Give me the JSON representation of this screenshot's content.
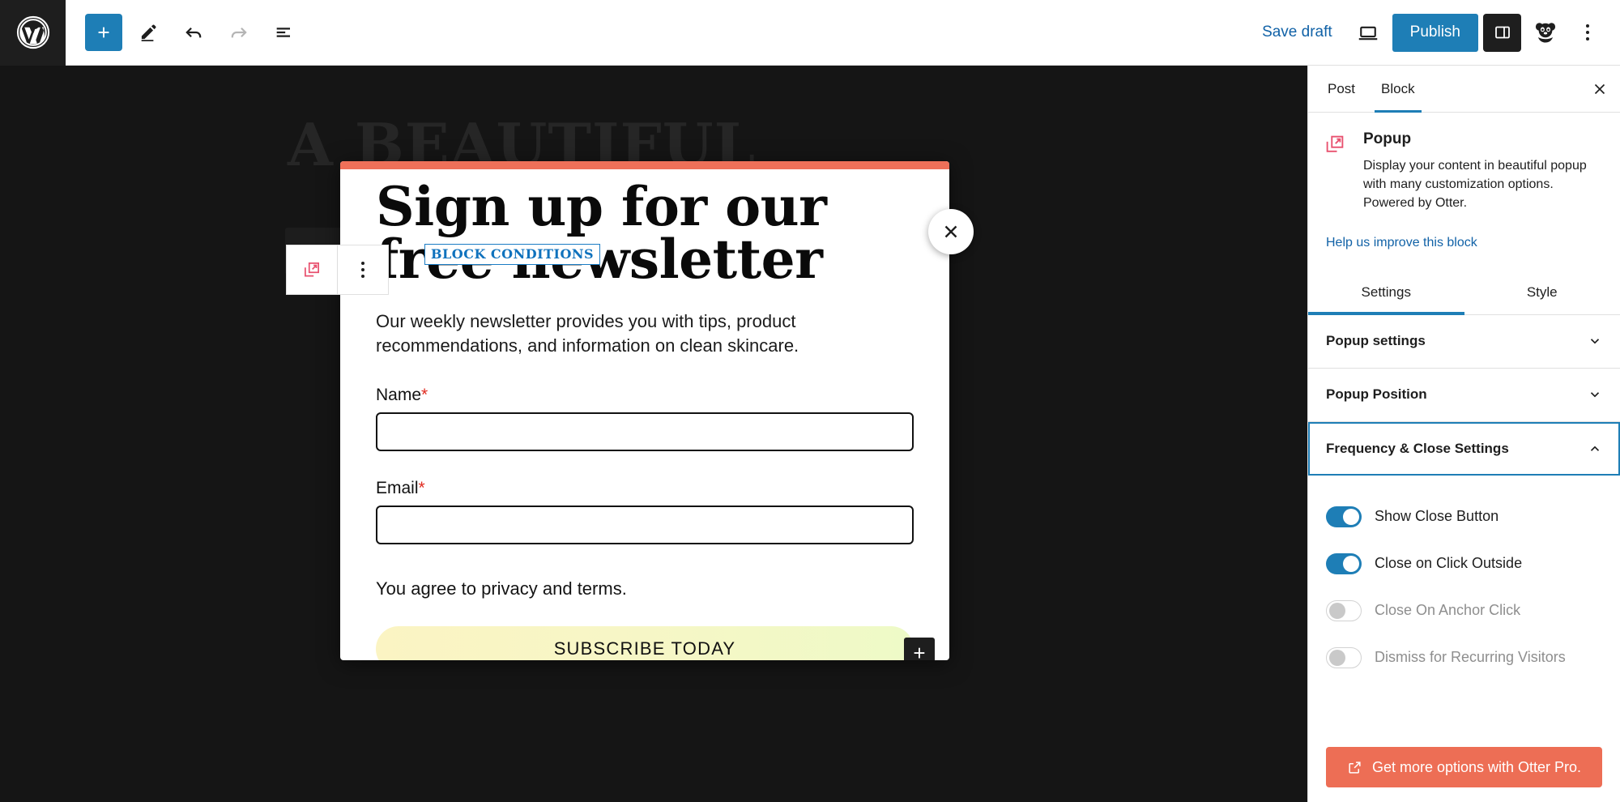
{
  "topbar": {
    "logo_icon": "wordpress-logo-icon",
    "add_block_icon": "plus-icon",
    "tools_icon": "pencil-icon",
    "undo_icon": "undo-arrow-icon",
    "redo_icon": "redo-arrow-icon",
    "list_view_icon": "document-outline-icon",
    "save_draft_label": "Save draft",
    "preview_icon": "laptop-preview-icon",
    "publish_label": "Publish",
    "settings_toggle_icon": "sidebar-panel-icon",
    "avatar_icon": "panda-avatar-icon",
    "more_icon": "kebab-menu-icon"
  },
  "canvas": {
    "ghost_title": "A BEAUTIFUL",
    "background_color": "#151515"
  },
  "block_toolbar": {
    "block_type_icon": "popup-block-icon",
    "more_options_icon": "kebab-menu-icon"
  },
  "popup": {
    "accent_color": "#ee7059",
    "title": "Sign up for our free newsletter",
    "description": "Our weekly newsletter provides you with tips, product recommendations, and information on clean skincare.",
    "block_conditions_badge": "BLOCK CONDITIONS",
    "close_icon": "close-x-icon",
    "fields": [
      {
        "label": "Name",
        "required": "*",
        "value": "",
        "placeholder": ""
      },
      {
        "label": "Email",
        "required": "*",
        "value": "",
        "placeholder": ""
      }
    ],
    "agree_text": "You agree to privacy and terms.",
    "subscribe_label": "SUBSCRIBE TODAY",
    "appender_icon": "plus-icon"
  },
  "sidebar": {
    "tabs": [
      {
        "label": "Post",
        "active": false
      },
      {
        "label": "Block",
        "active": true
      }
    ],
    "close_icon": "close-x-icon",
    "block": {
      "icon": "popup-block-icon",
      "name": "Popup",
      "description": "Display your content in beautiful popup with many customization options. Powered by Otter."
    },
    "help_link": "Help us improve this block",
    "style_tabs": [
      {
        "label": "Settings",
        "active": true
      },
      {
        "label": "Style",
        "active": false
      }
    ],
    "panels": [
      {
        "label": "Popup settings",
        "expanded": false,
        "focused": false
      },
      {
        "label": "Popup Position",
        "expanded": false,
        "focused": false
      },
      {
        "label": "Frequency & Close Settings",
        "expanded": true,
        "focused": true
      }
    ],
    "toggles": [
      {
        "label": "Show Close Button",
        "on": true,
        "disabled": false
      },
      {
        "label": "Close on Click Outside",
        "on": true,
        "disabled": false
      },
      {
        "label": "Close On Anchor Click",
        "on": false,
        "disabled": true
      },
      {
        "label": "Dismiss for Recurring Visitors",
        "on": false,
        "disabled": true
      }
    ],
    "pro_button": {
      "label": "Get more options with Otter Pro.",
      "icon": "external-link-icon",
      "color": "#ed6e55"
    }
  }
}
